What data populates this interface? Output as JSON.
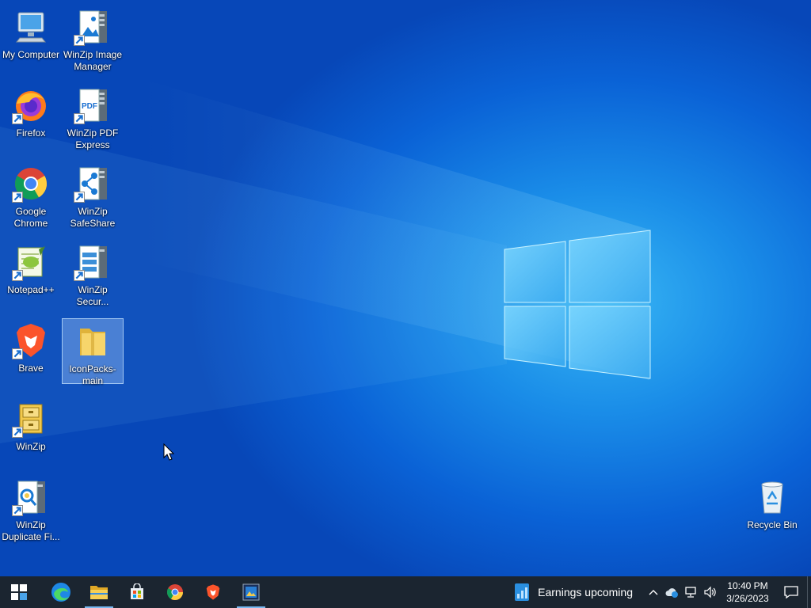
{
  "desktop": {
    "icons": [
      {
        "label": "My Computer",
        "icon": "computer-icon"
      },
      {
        "label": "WinZip Image Manager",
        "icon": "winzip-image-icon"
      },
      {
        "label": "Firefox",
        "icon": "firefox-icon"
      },
      {
        "label": "WinZip PDF Express",
        "icon": "winzip-pdf-icon"
      },
      {
        "label": "Google Chrome",
        "icon": "chrome-icon"
      },
      {
        "label": "WinZip SafeShare",
        "icon": "winzip-safeshare-icon"
      },
      {
        "label": "Notepad++",
        "icon": "notepadpp-icon"
      },
      {
        "label": "WinZip Secur...",
        "icon": "winzip-secure-icon"
      },
      {
        "label": "Brave",
        "icon": "brave-icon"
      },
      {
        "label": "IconPacks-main",
        "icon": "folder-icon"
      },
      {
        "label": "WinZip",
        "icon": "winzip-icon"
      },
      {
        "label": "WinZip Duplicate Fi...",
        "icon": "winzip-duplicate-icon"
      },
      {
        "label": "Recycle Bin",
        "icon": "recycle-bin-icon"
      }
    ]
  },
  "taskbar": {
    "apps": [
      "start-icon",
      "edge-icon",
      "file-explorer-icon",
      "store-icon",
      "chrome-icon",
      "brave-icon",
      "winzip-image-icon"
    ],
    "news_text": "Earnings upcoming",
    "time": "10:40 PM",
    "date": "3/26/2023"
  },
  "colors": {
    "taskbar": "#1b2530",
    "desktop_accent": "#0a62d6"
  }
}
